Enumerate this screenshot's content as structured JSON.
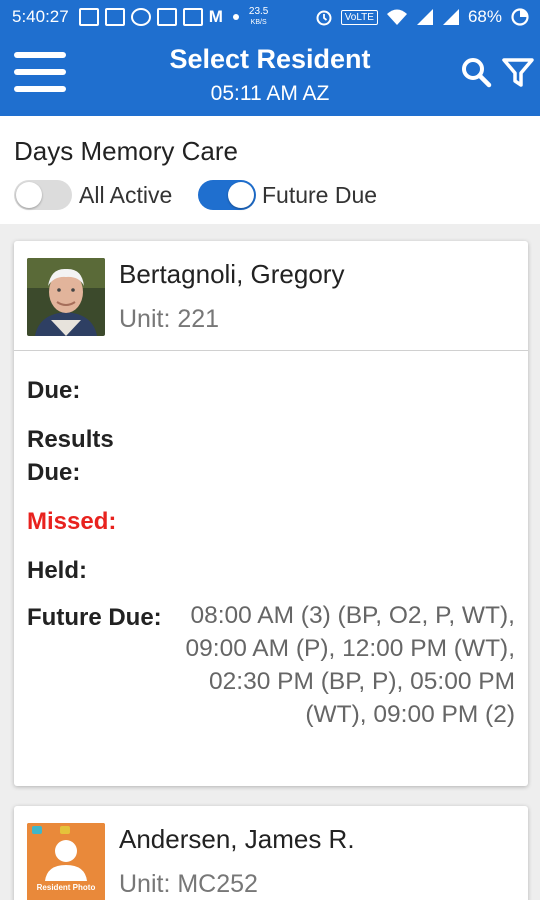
{
  "status_bar": {
    "time": "5:40:27",
    "net_speed": "23.5",
    "net_unit": "KB/S",
    "volte": "VoLTE",
    "battery": "68%"
  },
  "app_bar": {
    "title": "Select Resident",
    "subtitle": "05:11 AM AZ"
  },
  "facility": {
    "name": "Days Memory Care",
    "toggles": [
      {
        "label": "All Active",
        "on": false
      },
      {
        "label": "Future Due",
        "on": true
      }
    ]
  },
  "residents": [
    {
      "name": "Bertagnoli, Gregory",
      "unit": "Unit: 221",
      "fields": {
        "due_label": "Due:",
        "results_due_label_line1": "Results",
        "results_due_label_line2": "Due:",
        "missed_label": "Missed:",
        "held_label": "Held:",
        "future_due_label": "Future Due:",
        "future_due_value": "08:00 AM (3) (BP, O2, P, WT), 09:00 AM (P), 12:00 PM (WT), 02:30 PM (BP, P), 05:00 PM (WT), 09:00 PM (2)"
      }
    },
    {
      "name": "Andersen, James R.",
      "unit": "Unit: MC252",
      "photo_caption": "Resident Photo"
    }
  ],
  "colors": {
    "primary": "#1f6fcf",
    "missed": "#e8221e",
    "placeholder_photo": "#e9893a"
  },
  "icons": [
    "menu-icon",
    "search-icon",
    "filter-icon",
    "wifi-icon",
    "signal-icon",
    "battery-icon",
    "alarm-icon"
  ]
}
